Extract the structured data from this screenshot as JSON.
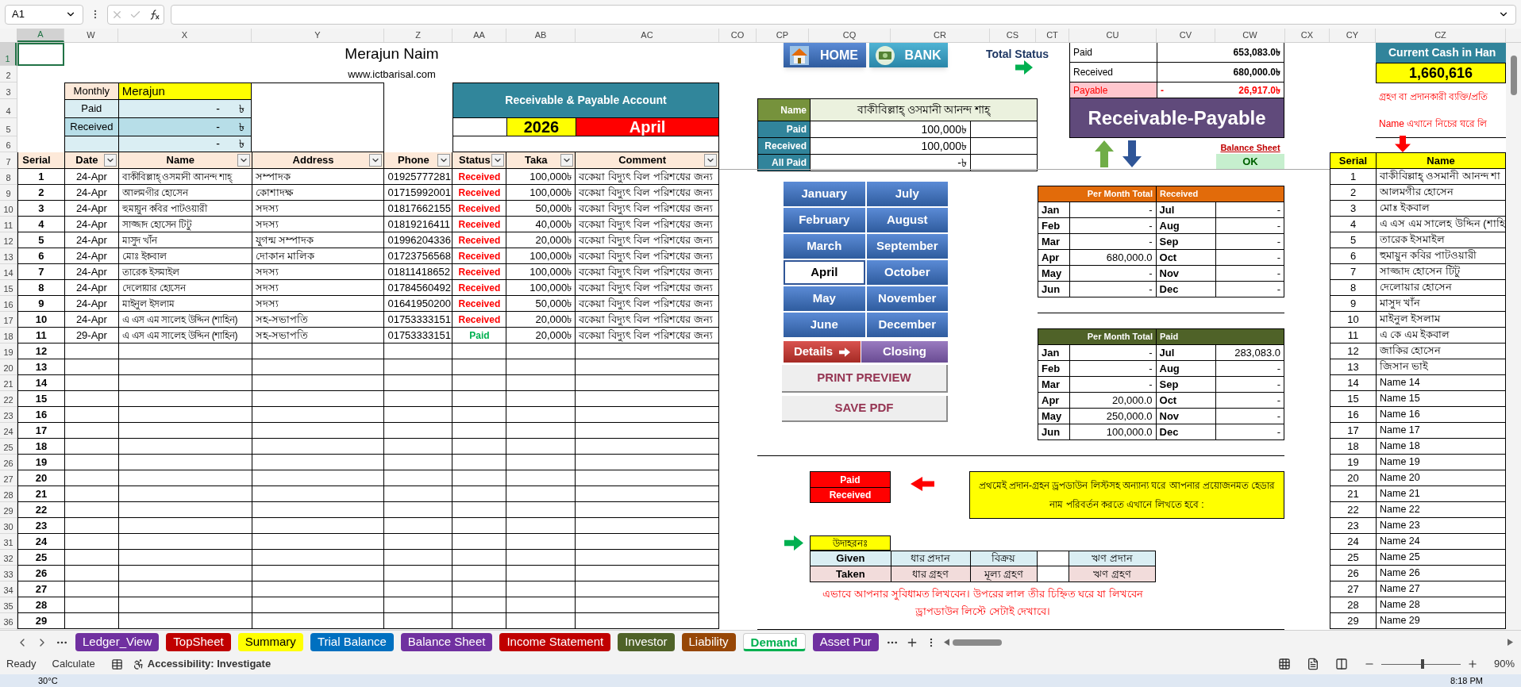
{
  "formula_bar": {
    "name_box": "A1"
  },
  "columns": [
    {
      "label": "A",
      "selected": true
    },
    {
      "label": "W",
      "selected": false
    },
    {
      "label": "X",
      "selected": false
    },
    {
      "label": "Y",
      "selected": false
    },
    {
      "label": "Z",
      "selected": false
    },
    {
      "label": "AA",
      "selected": false
    },
    {
      "label": "AB",
      "selected": false
    },
    {
      "label": "AC",
      "selected": false
    },
    {
      "label": "CO",
      "selected": false
    },
    {
      "label": "CP",
      "selected": false
    },
    {
      "label": "CQ",
      "selected": false
    },
    {
      "label": "CR",
      "selected": false
    },
    {
      "label": "CS",
      "selected": false
    },
    {
      "label": "CT",
      "selected": false
    },
    {
      "label": "CU",
      "selected": false
    },
    {
      "label": "CV",
      "selected": false
    },
    {
      "label": "CW",
      "selected": false
    },
    {
      "label": "CX",
      "selected": false
    },
    {
      "label": "CY",
      "selected": false
    },
    {
      "label": "CZ",
      "selected": false
    }
  ],
  "row_numbers": [
    {
      "label": "1",
      "selected": true
    },
    {
      "label": "2",
      "selected": false
    },
    {
      "label": "3",
      "selected": false
    },
    {
      "label": "4",
      "selected": false
    },
    {
      "label": "5",
      "selected": false
    },
    {
      "label": "6",
      "selected": false
    },
    {
      "label": "7",
      "selected": false
    },
    {
      "label": "8",
      "selected": false
    },
    {
      "label": "9",
      "selected": false
    },
    {
      "label": "10",
      "selected": false
    },
    {
      "label": "11",
      "selected": false
    },
    {
      "label": "12",
      "selected": false
    },
    {
      "label": "13",
      "selected": false
    },
    {
      "label": "14",
      "selected": false
    },
    {
      "label": "15",
      "selected": false
    },
    {
      "label": "16",
      "selected": false
    },
    {
      "label": "17",
      "selected": false
    },
    {
      "label": "18",
      "selected": false
    },
    {
      "label": "19",
      "selected": false
    },
    {
      "label": "20",
      "selected": false
    },
    {
      "label": "21",
      "selected": false
    },
    {
      "label": "22",
      "selected": false
    },
    {
      "label": "23",
      "selected": false
    },
    {
      "label": "24",
      "selected": false
    },
    {
      "label": "25",
      "selected": false
    },
    {
      "label": "26",
      "selected": false
    },
    {
      "label": "27",
      "selected": false
    },
    {
      "label": "28",
      "selected": false
    },
    {
      "label": "29",
      "selected": false
    },
    {
      "label": "30",
      "selected": false
    },
    {
      "label": "31",
      "selected": false
    },
    {
      "label": "32",
      "selected": false
    },
    {
      "label": "33",
      "selected": false
    },
    {
      "label": "34",
      "selected": false
    },
    {
      "label": "35",
      "selected": false
    },
    {
      "label": "36",
      "selected": false
    }
  ],
  "title": "Merajun Naim",
  "website": "www.ictbarisal.com",
  "summary_box": [
    {
      "kind": "name",
      "label": "Monthly",
      "value": "Merajun"
    },
    {
      "kind": "amount",
      "label": "Paid",
      "value": "-",
      "currency": "৳",
      "color": "#daeef3"
    },
    {
      "kind": "amount",
      "label": "Received",
      "value": "-",
      "currency": "৳",
      "color": "#b7dee8"
    },
    {
      "kind": "amount",
      "value": "-",
      "currency": "৳",
      "color": "#daeef3"
    }
  ],
  "account_box": {
    "title": "Receivable & Payable Account",
    "year": "2026",
    "month": "April"
  },
  "ledger": {
    "columns": [
      "Serial",
      "Date",
      "Name",
      "Address",
      "Phone",
      "Status",
      "Taka",
      "Comment"
    ],
    "rows": [
      {
        "serial": "1",
        "date": "24-Apr",
        "name": "বাকীবিল্লাহ্ ওসমানী আনন্দ শাহ্",
        "address": "সম্পাদক",
        "phone": "01925777281",
        "status": "Received",
        "kind": "received",
        "taka": "100,000৳",
        "comment": "বকেয়া বিদ্যুৎ বিল পরিশধের জন্য"
      },
      {
        "serial": "2",
        "date": "24-Apr",
        "name": "আলমগীর হোসেন",
        "address": "কোশাদক্ষ",
        "phone": "01715992001",
        "status": "Received",
        "kind": "received",
        "taka": "100,000৳",
        "comment": "বকেয়া বিদ্যুৎ বিল পরিশধের জন্য"
      },
      {
        "serial": "3",
        "date": "24-Apr",
        "name": "হুমায়ুন কবির পাটওয়ারী",
        "address": "সদস্য",
        "phone": "01817662155",
        "status": "Received",
        "kind": "received",
        "taka": "50,000৳",
        "comment": "বকেয়া বিদ্যুৎ বিল পরিশধের জন্য"
      },
      {
        "serial": "4",
        "date": "24-Apr",
        "name": "সাজ্জাদ হোসেন টিটু",
        "address": "সদস্য",
        "phone": "01819216411",
        "status": "Received",
        "kind": "received",
        "taka": "40,000৳",
        "comment": "বকেয়া বিদ্যুৎ বিল পরিশধের জন্য"
      },
      {
        "serial": "5",
        "date": "24-Apr",
        "name": "মাসুদ খাঁন",
        "address": "যুগন্ম সম্পাদক",
        "phone": "01996204336",
        "status": "Received",
        "kind": "received",
        "taka": "20,000৳",
        "comment": "বকেয়া বিদ্যুৎ বিল পরিশধের জন্য"
      },
      {
        "serial": "6",
        "date": "24-Apr",
        "name": "মোঃ ইকবাল",
        "address": "দোকান মালিক",
        "phone": "01723756568",
        "status": "Received",
        "kind": "received",
        "taka": "100,000৳",
        "comment": "বকেয়া বিদ্যুৎ বিল পরিশধের জন্য"
      },
      {
        "serial": "7",
        "date": "24-Apr",
        "name": "তারেক ইসমাইল",
        "address": "সদস্য",
        "phone": "01811418652",
        "status": "Received",
        "kind": "received",
        "taka": "100,000৳",
        "comment": "বকেয়া বিদ্যুৎ বিল পরিশধের জন্য"
      },
      {
        "serial": "8",
        "date": "24-Apr",
        "name": "দেলোয়ার হোসেন",
        "address": "সদস্য",
        "phone": "01784560492",
        "status": "Received",
        "kind": "received",
        "taka": "100,000৳",
        "comment": "বকেয়া বিদ্যুৎ বিল পরিশধের জন্য"
      },
      {
        "serial": "9",
        "date": "24-Apr",
        "name": "মাইনুল ইসলাম",
        "address": "সদস্য",
        "phone": "01641950200",
        "status": "Received",
        "kind": "received",
        "taka": "50,000৳",
        "comment": "বকেয়া বিদ্যুৎ বিল পরিশধের জন্য"
      },
      {
        "serial": "10",
        "date": "24-Apr",
        "name": "এ এস এম সালেহ উদ্দিন (শাহিন)",
        "address": "সহ-সভাপতি",
        "phone": "01753333151",
        "status": "Received",
        "kind": "received",
        "taka": "20,000৳",
        "comment": "বকেয়া বিদ্যুৎ বিল পরিশধের জন্য"
      },
      {
        "serial": "11",
        "date": "29-Apr",
        "name": "এ এস এম সালেহ উদ্দিন (শাহিন)",
        "address": "সহ-সভাপতি",
        "phone": "01753333151",
        "status": "Paid",
        "kind": "paid",
        "taka": "20,000৳",
        "comment": "বকেয়া বিদ্যুৎ বিল পরিশধের জন্য"
      },
      {
        "serial": "12"
      },
      {
        "serial": "13"
      },
      {
        "serial": "14"
      },
      {
        "serial": "15"
      },
      {
        "serial": "16"
      },
      {
        "serial": "17"
      },
      {
        "serial": "18"
      },
      {
        "serial": "19"
      },
      {
        "serial": "20"
      },
      {
        "serial": "21"
      },
      {
        "serial": "22"
      },
      {
        "serial": "23"
      },
      {
        "serial": "24"
      },
      {
        "serial": "25"
      },
      {
        "serial": "26"
      },
      {
        "serial": "27"
      },
      {
        "serial": "28"
      },
      {
        "serial": "29"
      }
    ]
  },
  "nav_buttons": [
    {
      "label": "HOME",
      "kind": "home"
    },
    {
      "label": "BANK",
      "kind": "bank"
    }
  ],
  "total_status": "Total Status",
  "totals": [
    {
      "label": "Paid",
      "value": "653,083.0৳",
      "kind": "normal"
    },
    {
      "label": "Received",
      "value": "680,000.0৳",
      "kind": "normal"
    },
    {
      "label": "Payable",
      "sign": "-",
      "value": "26,917.0৳",
      "kind": "alert"
    }
  ],
  "banner": "Receivable-Payable",
  "balance_link": "Balance Sheet",
  "status_ok": "OK",
  "person": [
    {
      "kind": "name",
      "label": "Name",
      "value": "বাকীবিল্লাহ্ ওসমানী আনন্দ শাহ্"
    },
    {
      "kind": "amount",
      "label": "Paid",
      "value": "100,000৳"
    },
    {
      "kind": "amount",
      "label": "Received",
      "value": "100,000৳"
    },
    {
      "kind": "amount",
      "label": "All Paid",
      "value": "-৳"
    }
  ],
  "months": [
    {
      "label": "January",
      "selected": false
    },
    {
      "label": "July",
      "selected": false
    },
    {
      "label": "February",
      "selected": false
    },
    {
      "label": "August",
      "selected": false
    },
    {
      "label": "March",
      "selected": false
    },
    {
      "label": "September",
      "selected": false
    },
    {
      "label": "April",
      "selected": true
    },
    {
      "label": "October",
      "selected": false
    },
    {
      "label": "May",
      "selected": false
    },
    {
      "label": "November",
      "selected": false
    },
    {
      "label": "June",
      "selected": false
    },
    {
      "label": "December",
      "selected": false
    }
  ],
  "actions": [
    {
      "label": "Details",
      "kind": "details"
    },
    {
      "label": "Closing",
      "kind": "closing"
    }
  ],
  "print_buttons": [
    "PRINT PREVIEW",
    "SAVE PDF"
  ],
  "monthly_tables": [
    {
      "kind": "received",
      "title_left": "Per Month Total",
      "title_right": "Received",
      "rows": [
        [
          "Jan",
          "-",
          "Jul",
          "-"
        ],
        [
          "Feb",
          "-",
          "Aug",
          "-"
        ],
        [
          "Mar",
          "-",
          "Sep",
          "-"
        ],
        [
          "Apr",
          "680,000.0",
          "Oct",
          "-"
        ],
        [
          "May",
          "-",
          "Nov",
          "-"
        ],
        [
          "Jun",
          "-",
          "Dec",
          "-"
        ]
      ]
    },
    {
      "kind": "paid",
      "title_left": "Per Month Total",
      "title_right": "Paid",
      "rows": [
        [
          "Jan",
          "-",
          "Jul",
          "283,083.0"
        ],
        [
          "Feb",
          "-",
          "Aug",
          "-"
        ],
        [
          "Mar",
          "-",
          "Sep",
          "-"
        ],
        [
          "Apr",
          "20,000.0",
          "Oct",
          "-"
        ],
        [
          "May",
          "250,000.0",
          "Nov",
          "-"
        ],
        [
          "Jun",
          "100,000.0",
          "Dec",
          "-"
        ]
      ]
    }
  ],
  "legend": [
    "Paid",
    "Received"
  ],
  "note": "প্রথমেই প্রদান-গ্রহন ড্রপডাউন লিস্টসহ অন্যান্য ঘরে আপনার প্রয়োজনমত হেডার নাম পরিবর্তন করতে এখানে লিখতে হবে :",
  "example": {
    "label": "উদাহরনঃ",
    "rows": [
      {
        "kind": "given",
        "label": "Given",
        "col_1": "ধার প্রদান",
        "col_2": "বিক্রয়",
        "col_4": "ঋণ প্রদান"
      },
      {
        "kind": "taken",
        "label": "Taken",
        "col_1": "ধার গ্রহণ",
        "col_2": "মূল্য গ্রহণ",
        "col_4": "ঋণ গ্রহণ"
      }
    ]
  },
  "example_note": "এভাবে আপনার সুবিধামত লিখবেন। উপরের লাল তীর চিহ্নিত ঘরে যা লিখবেন ড্রাপডাউন লিস্টে সেটাই দেখাবে।",
  "cash": {
    "title": "Current Cash in Han",
    "value": "1,660,616"
  },
  "instructions": [
    "গ্রহণ বা প্রদানকারী ব্যক্তি/প্রতি",
    "Name এখানে নিচের ঘরে লি"
  ],
  "names": {
    "columns": [
      "Serial",
      "Name"
    ],
    "rows": [
      [
        "1",
        "বাকীবিল্লাহ্ ওসমানী আনন্দ শা"
      ],
      [
        "2",
        "আলমগীর হোসেন"
      ],
      [
        "3",
        "মোঃ ইকবাল"
      ],
      [
        "4",
        "এ এস এম সালেহ উদ্দিন (শাহি"
      ],
      [
        "5",
        "তারেক ইসমাইল"
      ],
      [
        "6",
        "হুমায়ুন কবির পাটওয়ারী"
      ],
      [
        "7",
        "সাজ্জাদ হোসেন টিটু"
      ],
      [
        "8",
        "দেলোয়ার হোসেন"
      ],
      [
        "9",
        "মাসুদ খাঁন"
      ],
      [
        "10",
        "মাইনুল ইসলাম"
      ],
      [
        "11",
        "এ কে এম ইকবাল"
      ],
      [
        "12",
        "জাকির হোসেন"
      ],
      [
        "13",
        "জিসান ভাই"
      ],
      [
        "14",
        "Name 14"
      ],
      [
        "15",
        "Name 15"
      ],
      [
        "16",
        "Name 16"
      ],
      [
        "17",
        "Name 17"
      ],
      [
        "18",
        "Name 18"
      ],
      [
        "19",
        "Name 19"
      ],
      [
        "20",
        "Name 20"
      ],
      [
        "21",
        "Name 21"
      ],
      [
        "22",
        "Name 22"
      ],
      [
        "23",
        "Name 23"
      ],
      [
        "24",
        "Name 24"
      ],
      [
        "25",
        "Name 25"
      ],
      [
        "26",
        "Name 26"
      ],
      [
        "27",
        "Name 27"
      ],
      [
        "28",
        "Name 28"
      ],
      [
        "29",
        "Name 29"
      ]
    ]
  },
  "sheet_tabs": [
    {
      "label": "Ledger_View",
      "color": "#7030a0",
      "selected": false
    },
    {
      "label": "TopSheet",
      "color": "#c00000",
      "selected": false
    },
    {
      "label": "Summary",
      "color": "#ffff00",
      "selected": false
    },
    {
      "label": "Trial Balance",
      "color": "#0070c0",
      "selected": false
    },
    {
      "label": "Balance Sheet",
      "color": "#7030a0",
      "selected": false
    },
    {
      "label": "Income Statement",
      "color": "#c00000",
      "selected": false
    },
    {
      "label": "Investor",
      "color": "#4f6228",
      "selected": false
    },
    {
      "label": "Liability",
      "color": "#974706",
      "selected": false
    },
    {
      "label": "Demand",
      "color": "#00b050",
      "selected": true
    },
    {
      "label": "Asset Pur",
      "color": "#7030a0",
      "selected": false
    }
  ],
  "status_bar": {
    "items": [
      "Ready",
      "Calculate"
    ],
    "accessibility": "Accessibility: Investigate",
    "zoom": "90%",
    "level": 0.52
  },
  "taskbar": {
    "weather": "30°C",
    "time": "8:18 PM"
  }
}
